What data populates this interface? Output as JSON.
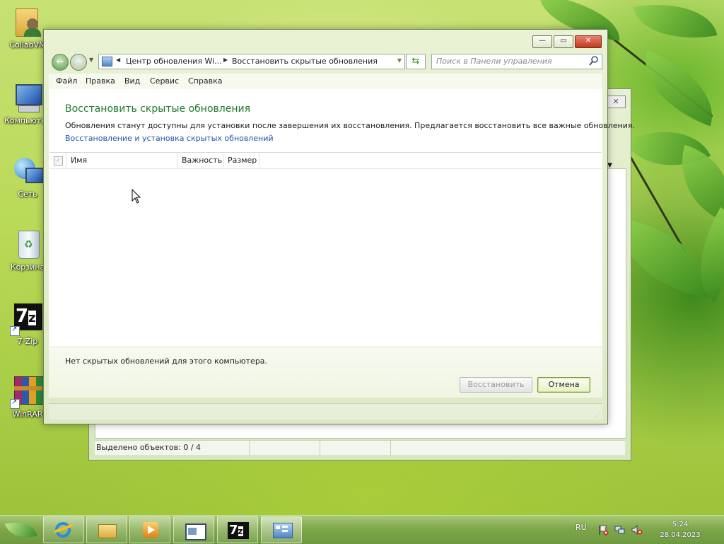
{
  "desktop": {
    "icons": [
      {
        "label": "CollabVM"
      },
      {
        "label": "Компьютер"
      },
      {
        "label": "Сеть"
      },
      {
        "label": "Корзина"
      },
      {
        "label": "7-Zip"
      },
      {
        "label": "WinRAR"
      }
    ]
  },
  "background_window": {
    "status_text": "Выделено объектов: 0 / 4"
  },
  "window": {
    "address": {
      "segment1": "Центр обновления Wi...",
      "segment2": "Восстановить скрытые обновления"
    },
    "search_placeholder": "Поиск в Панели управления",
    "menu": [
      "Файл",
      "Правка",
      "Вид",
      "Сервис",
      "Справка"
    ],
    "heading": "Восстановить скрытые обновления",
    "description": "Обновления станут доступны для установки после завершения их восстановления. Предлагается восстановить все важные обновления.",
    "help_link": "Восстановление и установка скрытых обновлений",
    "columns": [
      "Имя",
      "Важность",
      "Размер"
    ],
    "empty_message": "Нет скрытых обновлений для этого компьютера.",
    "buttons": {
      "restore": "Восстановить",
      "cancel": "Отмена"
    }
  },
  "taskbar": {
    "language": "RU",
    "time": "5:24",
    "date": "28.04.2023"
  }
}
